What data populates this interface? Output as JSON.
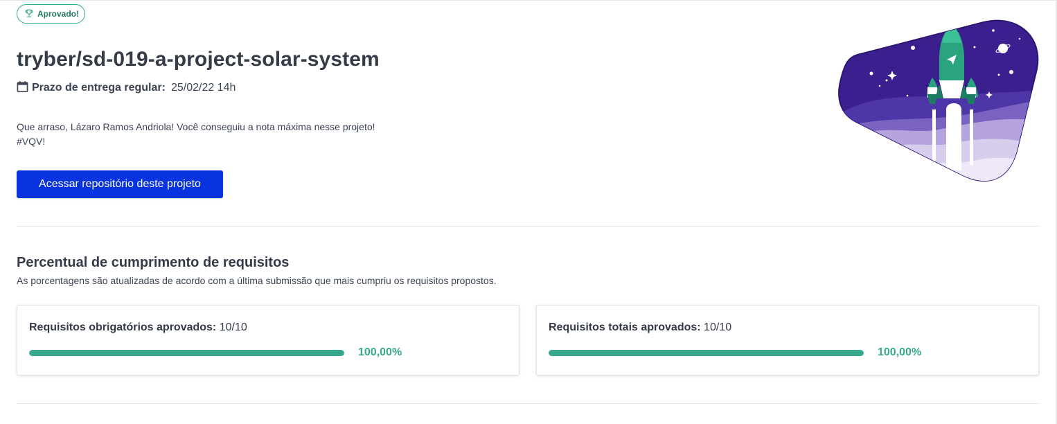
{
  "badge": {
    "label": "Aprovado!",
    "icon": "trophy-icon"
  },
  "project": {
    "title": "tryber/sd-019-a-project-solar-system",
    "deadline_label": "Prazo de entrega regular:",
    "deadline_value": "25/02/22 14h",
    "message_line1": "Que arraso, Lázaro Ramos Andriola! Você conseguiu a nota máxima nesse projeto!",
    "message_line2": "#VQV!",
    "repo_button": "Acessar repositório deste projeto"
  },
  "requirements": {
    "title": "Percentual de cumprimento de requisitos",
    "subtitle": "As porcentagens são atualizadas de acordo com a última submissão que mais cumpriu os requisitos propostos.",
    "cards": [
      {
        "label": "Requisitos obrigatórios aprovados:",
        "value": "10/10",
        "percent_text": "100,00%",
        "progress": 1.0
      },
      {
        "label": "Requisitos totais aprovados:",
        "value": "10/10",
        "percent_text": "100,00%",
        "progress": 1.0
      }
    ]
  },
  "colors": {
    "accent_green": "#36a88c",
    "button_blue": "#0a33e0",
    "illustration_purple": "#3b1f8f"
  }
}
